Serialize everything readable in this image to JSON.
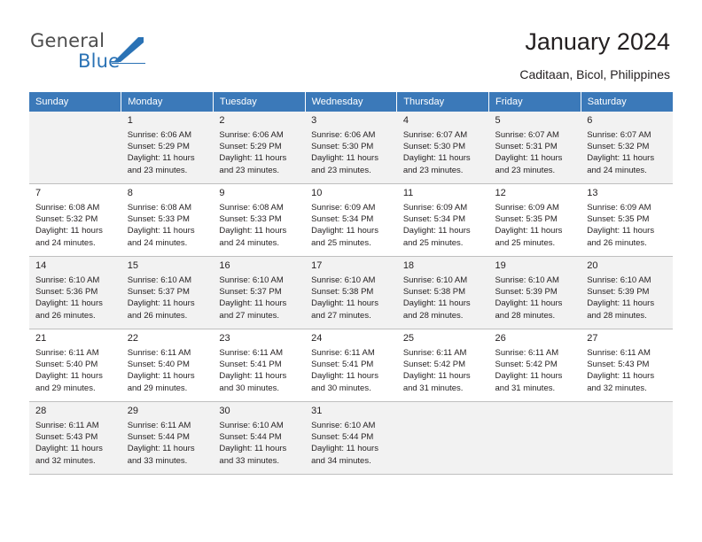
{
  "brand": {
    "name_part1": "General",
    "name_part2": "Blue"
  },
  "header": {
    "title": "January 2024",
    "location": "Caditaan, Bicol, Philippines"
  },
  "calendar": {
    "weekday_headers": [
      "Sunday",
      "Monday",
      "Tuesday",
      "Wednesday",
      "Thursday",
      "Friday",
      "Saturday"
    ],
    "weeks": [
      [
        {
          "day": "",
          "lines": []
        },
        {
          "day": "1",
          "lines": [
            "Sunrise: 6:06 AM",
            "Sunset: 5:29 PM",
            "Daylight: 11 hours",
            "and 23 minutes."
          ]
        },
        {
          "day": "2",
          "lines": [
            "Sunrise: 6:06 AM",
            "Sunset: 5:29 PM",
            "Daylight: 11 hours",
            "and 23 minutes."
          ]
        },
        {
          "day": "3",
          "lines": [
            "Sunrise: 6:06 AM",
            "Sunset: 5:30 PM",
            "Daylight: 11 hours",
            "and 23 minutes."
          ]
        },
        {
          "day": "4",
          "lines": [
            "Sunrise: 6:07 AM",
            "Sunset: 5:30 PM",
            "Daylight: 11 hours",
            "and 23 minutes."
          ]
        },
        {
          "day": "5",
          "lines": [
            "Sunrise: 6:07 AM",
            "Sunset: 5:31 PM",
            "Daylight: 11 hours",
            "and 23 minutes."
          ]
        },
        {
          "day": "6",
          "lines": [
            "Sunrise: 6:07 AM",
            "Sunset: 5:32 PM",
            "Daylight: 11 hours",
            "and 24 minutes."
          ]
        }
      ],
      [
        {
          "day": "7",
          "lines": [
            "Sunrise: 6:08 AM",
            "Sunset: 5:32 PM",
            "Daylight: 11 hours",
            "and 24 minutes."
          ]
        },
        {
          "day": "8",
          "lines": [
            "Sunrise: 6:08 AM",
            "Sunset: 5:33 PM",
            "Daylight: 11 hours",
            "and 24 minutes."
          ]
        },
        {
          "day": "9",
          "lines": [
            "Sunrise: 6:08 AM",
            "Sunset: 5:33 PM",
            "Daylight: 11 hours",
            "and 24 minutes."
          ]
        },
        {
          "day": "10",
          "lines": [
            "Sunrise: 6:09 AM",
            "Sunset: 5:34 PM",
            "Daylight: 11 hours",
            "and 25 minutes."
          ]
        },
        {
          "day": "11",
          "lines": [
            "Sunrise: 6:09 AM",
            "Sunset: 5:34 PM",
            "Daylight: 11 hours",
            "and 25 minutes."
          ]
        },
        {
          "day": "12",
          "lines": [
            "Sunrise: 6:09 AM",
            "Sunset: 5:35 PM",
            "Daylight: 11 hours",
            "and 25 minutes."
          ]
        },
        {
          "day": "13",
          "lines": [
            "Sunrise: 6:09 AM",
            "Sunset: 5:35 PM",
            "Daylight: 11 hours",
            "and 26 minutes."
          ]
        }
      ],
      [
        {
          "day": "14",
          "lines": [
            "Sunrise: 6:10 AM",
            "Sunset: 5:36 PM",
            "Daylight: 11 hours",
            "and 26 minutes."
          ]
        },
        {
          "day": "15",
          "lines": [
            "Sunrise: 6:10 AM",
            "Sunset: 5:37 PM",
            "Daylight: 11 hours",
            "and 26 minutes."
          ]
        },
        {
          "day": "16",
          "lines": [
            "Sunrise: 6:10 AM",
            "Sunset: 5:37 PM",
            "Daylight: 11 hours",
            "and 27 minutes."
          ]
        },
        {
          "day": "17",
          "lines": [
            "Sunrise: 6:10 AM",
            "Sunset: 5:38 PM",
            "Daylight: 11 hours",
            "and 27 minutes."
          ]
        },
        {
          "day": "18",
          "lines": [
            "Sunrise: 6:10 AM",
            "Sunset: 5:38 PM",
            "Daylight: 11 hours",
            "and 28 minutes."
          ]
        },
        {
          "day": "19",
          "lines": [
            "Sunrise: 6:10 AM",
            "Sunset: 5:39 PM",
            "Daylight: 11 hours",
            "and 28 minutes."
          ]
        },
        {
          "day": "20",
          "lines": [
            "Sunrise: 6:10 AM",
            "Sunset: 5:39 PM",
            "Daylight: 11 hours",
            "and 28 minutes."
          ]
        }
      ],
      [
        {
          "day": "21",
          "lines": [
            "Sunrise: 6:11 AM",
            "Sunset: 5:40 PM",
            "Daylight: 11 hours",
            "and 29 minutes."
          ]
        },
        {
          "day": "22",
          "lines": [
            "Sunrise: 6:11 AM",
            "Sunset: 5:40 PM",
            "Daylight: 11 hours",
            "and 29 minutes."
          ]
        },
        {
          "day": "23",
          "lines": [
            "Sunrise: 6:11 AM",
            "Sunset: 5:41 PM",
            "Daylight: 11 hours",
            "and 30 minutes."
          ]
        },
        {
          "day": "24",
          "lines": [
            "Sunrise: 6:11 AM",
            "Sunset: 5:41 PM",
            "Daylight: 11 hours",
            "and 30 minutes."
          ]
        },
        {
          "day": "25",
          "lines": [
            "Sunrise: 6:11 AM",
            "Sunset: 5:42 PM",
            "Daylight: 11 hours",
            "and 31 minutes."
          ]
        },
        {
          "day": "26",
          "lines": [
            "Sunrise: 6:11 AM",
            "Sunset: 5:42 PM",
            "Daylight: 11 hours",
            "and 31 minutes."
          ]
        },
        {
          "day": "27",
          "lines": [
            "Sunrise: 6:11 AM",
            "Sunset: 5:43 PM",
            "Daylight: 11 hours",
            "and 32 minutes."
          ]
        }
      ],
      [
        {
          "day": "28",
          "lines": [
            "Sunrise: 6:11 AM",
            "Sunset: 5:43 PM",
            "Daylight: 11 hours",
            "and 32 minutes."
          ]
        },
        {
          "day": "29",
          "lines": [
            "Sunrise: 6:11 AM",
            "Sunset: 5:44 PM",
            "Daylight: 11 hours",
            "and 33 minutes."
          ]
        },
        {
          "day": "30",
          "lines": [
            "Sunrise: 6:10 AM",
            "Sunset: 5:44 PM",
            "Daylight: 11 hours",
            "and 33 minutes."
          ]
        },
        {
          "day": "31",
          "lines": [
            "Sunrise: 6:10 AM",
            "Sunset: 5:44 PM",
            "Daylight: 11 hours",
            "and 34 minutes."
          ]
        },
        {
          "day": "",
          "lines": []
        },
        {
          "day": "",
          "lines": []
        },
        {
          "day": "",
          "lines": []
        }
      ]
    ]
  },
  "colors": {
    "header_bar": "#3b79b9",
    "brand_blue": "#2a72b5",
    "shaded_row": "#f2f2f2"
  }
}
